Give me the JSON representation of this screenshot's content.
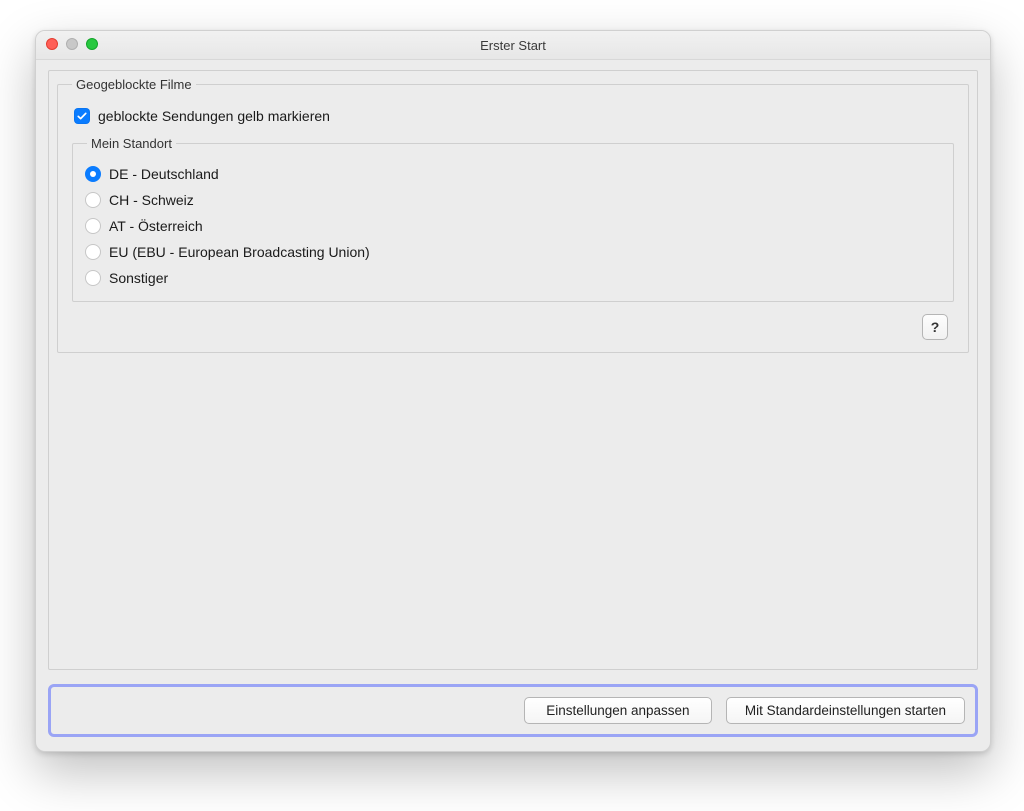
{
  "window": {
    "title": "Erster Start"
  },
  "geoblock": {
    "legend": "Geogeblockte Filme",
    "checkbox_label": "geblockte Sendungen gelb markieren",
    "checkbox_checked": true
  },
  "location": {
    "legend": "Mein Standort",
    "selected_index": 0,
    "options": [
      {
        "label": "DE - Deutschland"
      },
      {
        "label": "CH - Schweiz"
      },
      {
        "label": "AT - Österreich"
      },
      {
        "label": "EU (EBU - European Broadcasting Union)"
      },
      {
        "label": "Sonstiger"
      }
    ]
  },
  "help_icon": "?",
  "buttons": {
    "customize": "Einstellungen anpassen",
    "default": "Mit Standardeinstellungen starten"
  }
}
